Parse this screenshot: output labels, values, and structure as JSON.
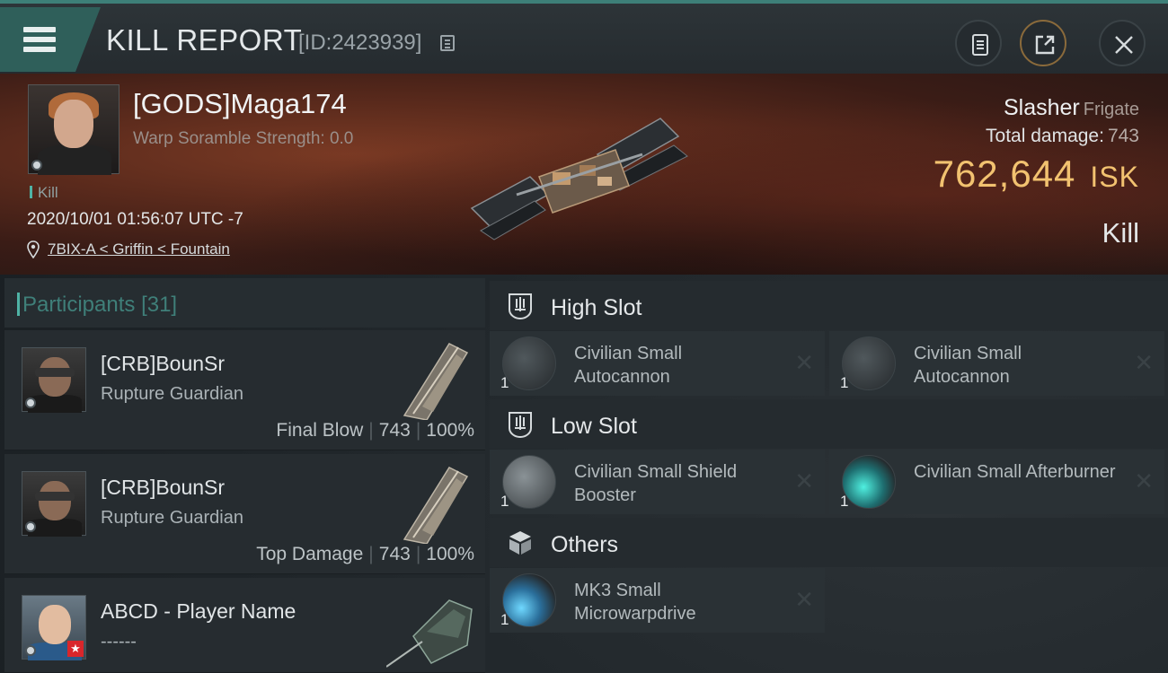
{
  "header": {
    "title": "KILL REPORT",
    "report_id": "[ID:2423939]",
    "buttons": [
      "clipboard-icon",
      "share-icon",
      "close-icon"
    ]
  },
  "victim": {
    "name": "[GODS]Maga174",
    "warp_scramble": "Warp Soramble Strength: 0.0",
    "tag": "Kill",
    "datetime": "2020/10/01 01:56:07 UTC -7",
    "location": "7BIX-A < Griffin < Fountain",
    "ship_name": "Slasher",
    "ship_class": "Frigate",
    "total_damage_label": "Total damage:",
    "total_damage_value": "743",
    "isk_value": "762,644",
    "isk_unit": "ISK",
    "kill_type": "Kill"
  },
  "participants": {
    "title": "Participants",
    "count": "[31]",
    "items": [
      {
        "name": "[CRB]BounSr",
        "ship": "Rupture Guardian",
        "role": "Final Blow",
        "damage": "743",
        "percent": "100%"
      },
      {
        "name": "[CRB]BounSr",
        "ship": "Rupture Guardian",
        "role": "Top Damage",
        "damage": "743",
        "percent": "100%"
      },
      {
        "name": "ABCD - Player Name",
        "ship": "------"
      }
    ]
  },
  "slots": {
    "high": {
      "label": "High Slot",
      "modules": [
        {
          "name": "Civilian Small Autocannon",
          "qty": "1"
        },
        {
          "name": "Civilian Small Autocannon",
          "qty": "1"
        }
      ]
    },
    "low": {
      "label": "Low Slot",
      "modules": [
        {
          "name": "Civilian Small Shield Booster",
          "qty": "1"
        },
        {
          "name": "Civilian Small Afterburner",
          "qty": "1"
        }
      ]
    },
    "others": {
      "label": "Others",
      "modules": [
        {
          "name": "MK3 Small Microwarpdrive",
          "qty": "1"
        }
      ]
    }
  },
  "colors": {
    "accent": "#4fb3a5",
    "isk": "#f2c270",
    "banner": "#5a2a1c"
  }
}
